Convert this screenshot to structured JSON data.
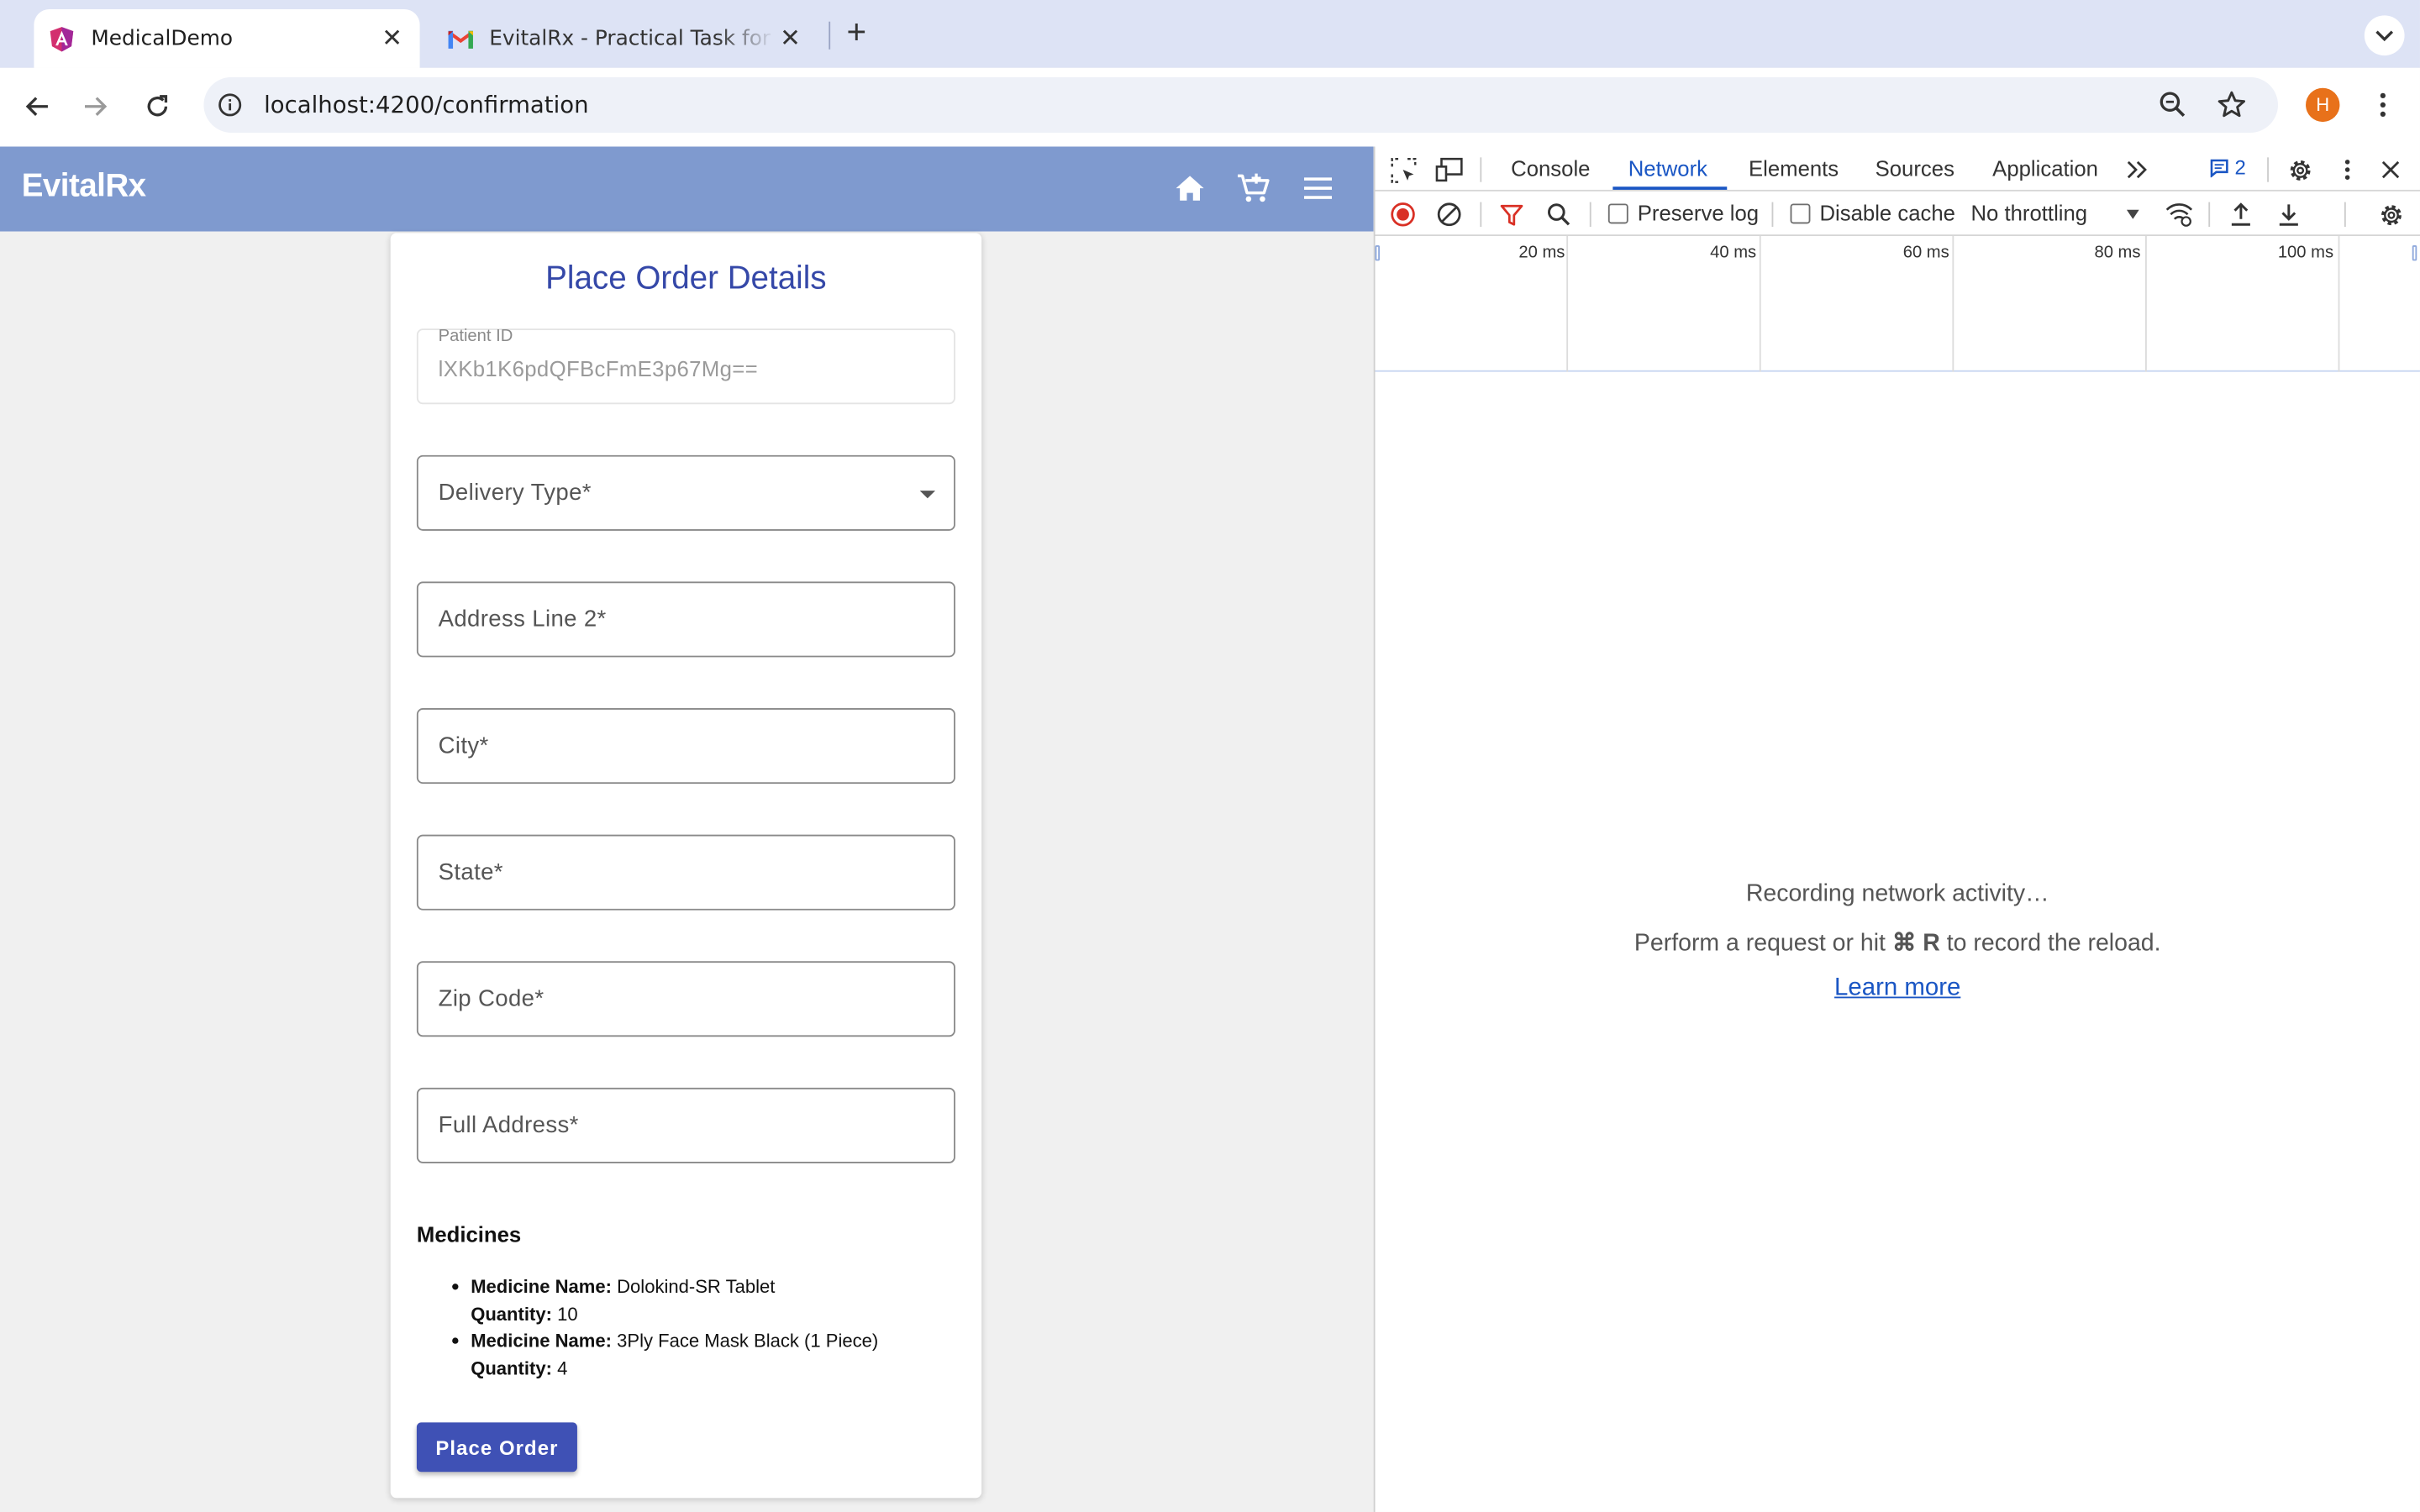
{
  "browser": {
    "tabs": [
      {
        "title": "MedicalDemo",
        "active": true,
        "icon": "angular-icon"
      },
      {
        "title": "EvitalRx - Practical Task for Angular Developer",
        "active": false,
        "icon": "gmail-icon"
      }
    ],
    "url": "localhost:4200/confirmation",
    "profile_initial": "H"
  },
  "app": {
    "brand": "EvitalRx",
    "appbar_color": "#7f9acf",
    "icons": [
      "home-icon",
      "cart-icon",
      "menu-icon"
    ]
  },
  "form": {
    "title": "Place Order Details",
    "patient_id": {
      "label": "Patient ID",
      "value": "lXKb1K6pdQFBcFmE3p67Mg=="
    },
    "delivery_type": {
      "placeholder": "Delivery Type*"
    },
    "address_line_2": {
      "placeholder": "Address Line 2*"
    },
    "city": {
      "placeholder": "City*"
    },
    "state": {
      "placeholder": "State*"
    },
    "zip_code": {
      "placeholder": "Zip Code*"
    },
    "full_address": {
      "placeholder": "Full Address*"
    },
    "medicines_heading": "Medicines",
    "medicine_name_label": "Medicine Name:",
    "quantity_label": "Quantity:",
    "medicines": [
      {
        "name": "Dolokind-SR Tablet",
        "quantity": "10"
      },
      {
        "name": "3Ply Face Mask Black (1 Piece)",
        "quantity": "4"
      }
    ],
    "submit_label": "Place Order",
    "accent_color": "#3f51b5"
  },
  "devtools": {
    "tabs": [
      "Console",
      "Network",
      "Elements",
      "Sources",
      "Application"
    ],
    "selected_tab": "Network",
    "issues_count": "2",
    "preserve_log": "Preserve log",
    "disable_cache": "Disable cache",
    "throttling": "No throttling",
    "timeline_ticks": [
      "20 ms",
      "40 ms",
      "60 ms",
      "80 ms",
      "100 ms"
    ],
    "empty_line_1": "Recording network activity…",
    "empty_line_2_pre": "Perform a request or hit",
    "empty_line_2_key": "⌘ R",
    "empty_line_2_post": "to record the reload.",
    "learn_more": "Learn more"
  }
}
